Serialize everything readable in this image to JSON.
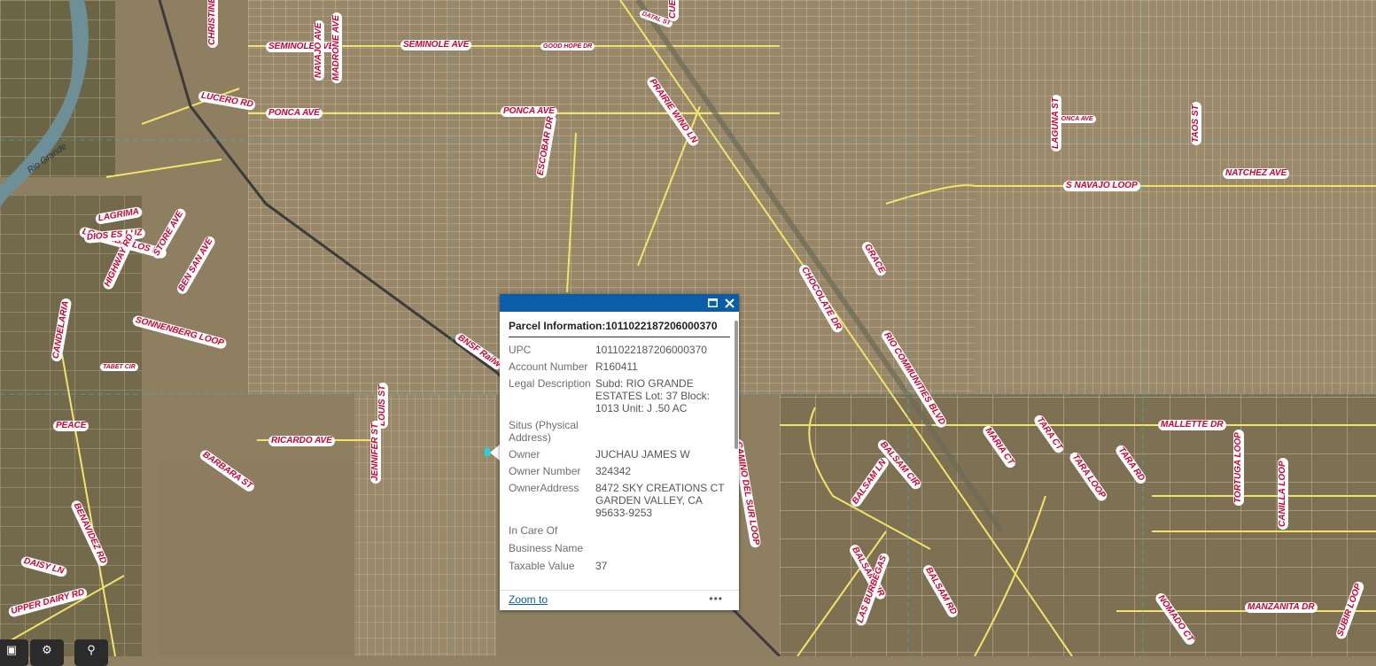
{
  "popup": {
    "title": "Parcel Information:1011022187206000370",
    "fields": [
      {
        "key": "UPC",
        "value": "1011022187206000370"
      },
      {
        "key": "Account Number",
        "value": "R160411"
      },
      {
        "key": "Legal Description",
        "value": "Subd: RIO GRANDE ESTATES Lot: 37 Block: 1013 Unit: J .50 AC"
      },
      {
        "key": "Situs (Physical Address)",
        "value": ""
      },
      {
        "key": "Owner",
        "value": "JUCHAU JAMES W"
      },
      {
        "key": "Owner Number",
        "value": "324342"
      },
      {
        "key": "OwnerAddress",
        "value": "8472 SKY CREATIONS CT GARDEN VALLEY, CA 95633-9253"
      },
      {
        "key": "In Care Of",
        "value": ""
      },
      {
        "key": "Business Name",
        "value": ""
      },
      {
        "key": "Taxable Value",
        "value": "37"
      }
    ],
    "zoom_label": "Zoom to",
    "more_label": "•••",
    "maximize_icon": "maximize-icon",
    "close_icon": "close-icon"
  },
  "map_labels": [
    "SEMINOLE AVE",
    "SEMINOLE AVE",
    "GOOD HOPE DR",
    "CHRISTINE DR",
    "NAVAJO AVE",
    "MADRONE AVE",
    "LUCERO RD",
    "PONCA AVE",
    "PONCA AVE",
    "PONCA AVE",
    "PRAIRIE WIND LN",
    "ESCOBAR DR",
    "LAGUNA ST",
    "TAOS ST",
    "NATCHEZ AVE",
    "S NAVAJO LOOP",
    "RIO COMMUNITIES BLVD",
    "CHOCOLATE DR",
    "GRACE",
    "BNSF Railw",
    "Rio Grande",
    "LAGRIMA",
    "LOS CABALLOS LN",
    "DIOS ES LUZ",
    "HIGHWAY RD",
    "STORE AVE",
    "BEN SAN AVE",
    "SONNENBERG LOOP",
    "TABET CIR",
    "CANDELARIA",
    "PEACE",
    "RICARDO AVE",
    "BARBARA ST",
    "LOUIS ST",
    "JENNIFER ST",
    "BENAVIDEZ RD",
    "DAISY LN",
    "UPPER DAIRY RD",
    "MALLETTE DR",
    "MARIA CT",
    "TARA CT",
    "TARA LOOP",
    "TARA RD",
    "BALSAM CIR",
    "BALSAM LN",
    "BALSAM CIR",
    "BALSAM RD",
    "LAS BURBEGAS",
    "TORTUGA LOOP",
    "CANILLA LOOP",
    "NOMADO CT",
    "MANZANITA DR",
    "SUBIR LOOP",
    "CAMINO DEL SUR LOOP",
    "DATAL ST",
    "CUERO"
  ],
  "toolbar": [
    "layers-icon",
    "measure-icon",
    "search-icon"
  ],
  "colors": {
    "header": "#0a5ea8",
    "road": "#f2e46a",
    "label": "#d4002f",
    "river": "#6d8f98"
  }
}
